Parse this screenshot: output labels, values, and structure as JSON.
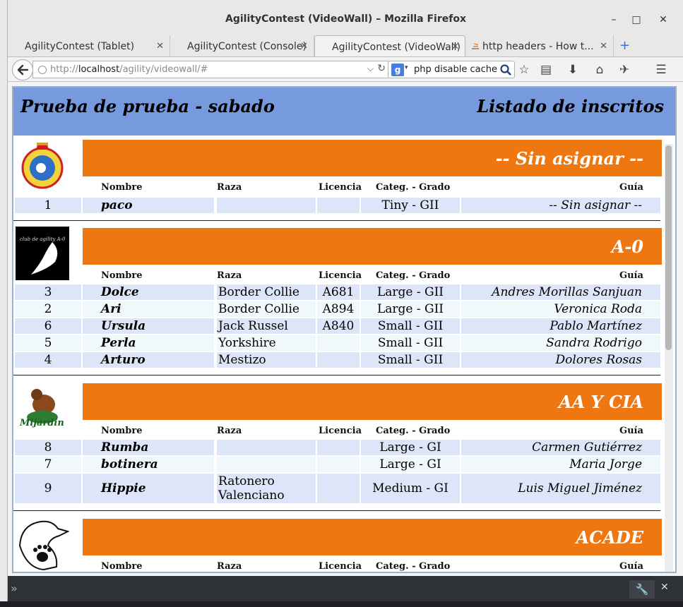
{
  "window": {
    "title": "AgilityContest (VideoWall) – Mozilla Firefox",
    "minimize": "–",
    "maximize": "□",
    "close": "✕"
  },
  "tabs": [
    {
      "label": "AgilityContest (Tablet)",
      "close": "✕"
    },
    {
      "label": "AgilityContest (Console)",
      "close": "✕"
    },
    {
      "label": "AgilityContest (VideoWall)",
      "close": "✕"
    },
    {
      "label": "http headers - How t...",
      "close": "✕"
    }
  ],
  "newtab": "+",
  "nav": {
    "url_prefix": "http://",
    "url_host": "localhost",
    "url_path": "/agility/videowall/#",
    "search_value": "php disable cache",
    "search_engine": "g",
    "icons": [
      "back-arrow",
      "bookmark-star",
      "reading-list",
      "download-arrow",
      "home",
      "plugin",
      "menu"
    ]
  },
  "page": {
    "title": "Prueba de prueba - sabado",
    "subtitle": "Listado de inscritos"
  },
  "columns": {
    "nombre": "Nombre",
    "raza": "Raza",
    "licencia": "Licencia",
    "categ": "Categ. - Grado",
    "guia": "Guía"
  },
  "clubs": [
    {
      "name": "-- Sin asignar --",
      "rows": [
        {
          "num": "1",
          "nombre": "paco",
          "raza": "",
          "licencia": "",
          "categ": "Tiny - GII",
          "guia": "-- Sin asignar --"
        }
      ]
    },
    {
      "name": "A-0",
      "logo_text": "club de agility A-0",
      "rows": [
        {
          "num": "3",
          "nombre": "Dolce",
          "raza": "Border Collie",
          "licencia": "A681",
          "categ": "Large - GII",
          "guia": "Andres Morillas Sanjuan"
        },
        {
          "num": "2",
          "nombre": "Ari",
          "raza": "Border Collie",
          "licencia": "A894",
          "categ": "Large - GII",
          "guia": "Veronica Roda"
        },
        {
          "num": "6",
          "nombre": "Ursula",
          "raza": "Jack Russel",
          "licencia": "A840",
          "categ": "Small - GII",
          "guia": "Pablo Martínez"
        },
        {
          "num": "5",
          "nombre": "Perla",
          "raza": "Yorkshire",
          "licencia": "",
          "categ": "Small - GII",
          "guia": "Sandra Rodrigo"
        },
        {
          "num": "4",
          "nombre": "Arturo",
          "raza": "Mestizo",
          "licencia": "",
          "categ": "Small - GII",
          "guia": "Dolores Rosas"
        }
      ]
    },
    {
      "name": "AA Y CIA",
      "rows": [
        {
          "num": "8",
          "nombre": "Rumba",
          "raza": "",
          "licencia": "",
          "categ": "Large - GI",
          "guia": "Carmen Gutiérrez"
        },
        {
          "num": "7",
          "nombre": "botinera",
          "raza": "",
          "licencia": "",
          "categ": "Large - GI",
          "guia": "Maria Jorge"
        },
        {
          "num": "9",
          "nombre": "Hippie",
          "raza": "Ratonero Valenciano",
          "licencia": "",
          "categ": "Medium - GI",
          "guia": "Luis Miguel Jiménez"
        }
      ]
    },
    {
      "name": "ACADE",
      "rows": []
    }
  ],
  "colors": {
    "header_blue": "#7799dd",
    "club_orange": "#ee7711",
    "row_even": "#dde6f8",
    "row_odd": "#f0f8fc"
  }
}
